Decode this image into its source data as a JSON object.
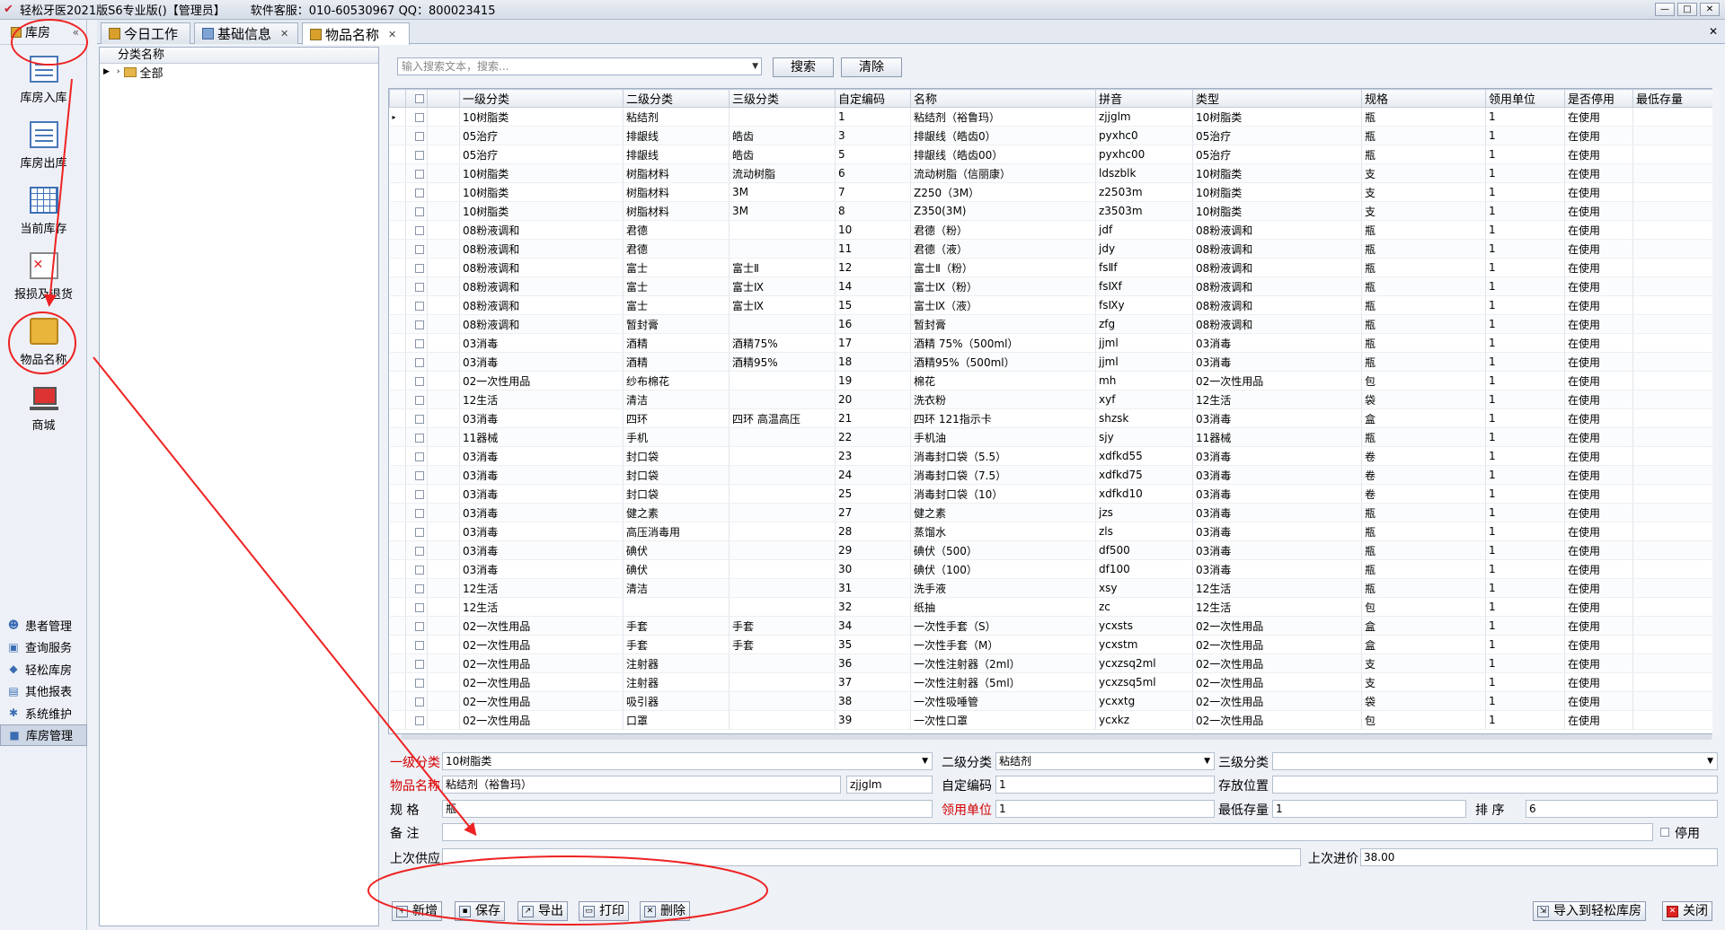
{
  "window": {
    "title": "轻松牙医2021版S6专业版()【管理员】",
    "service": "软件客服：010-60530967 QQ：800023415",
    "controls": [
      "—",
      "□",
      "✕"
    ]
  },
  "nav": {
    "header": "库房",
    "collapse": "«",
    "items": [
      {
        "label": "库房入库",
        "icon": "document-in-icon"
      },
      {
        "label": "库房出库",
        "icon": "document-out-icon"
      },
      {
        "label": "当前库存",
        "icon": "grid-table-icon"
      },
      {
        "label": "报损及退货",
        "icon": "return-icon"
      },
      {
        "label": "物品名称",
        "icon": "item-box-icon"
      },
      {
        "label": "商城",
        "icon": "cart-icon"
      }
    ],
    "modules": [
      {
        "label": "患者管理",
        "icon": "users-icon"
      },
      {
        "label": "查询服务",
        "icon": "query-icon"
      },
      {
        "label": "轻松库房",
        "icon": "warehouse-icon"
      },
      {
        "label": "其他报表",
        "icon": "report-icon"
      },
      {
        "label": "系统维护",
        "icon": "gear-icon"
      },
      {
        "label": "库房管理",
        "icon": "warehouse-manage-icon"
      }
    ]
  },
  "tabs": [
    {
      "label": "今日工作"
    },
    {
      "label": "基础信息"
    },
    {
      "label": "物品名称"
    }
  ],
  "tab_close": "✕",
  "tree": {
    "header": "分类名称",
    "root": "全部"
  },
  "search": {
    "placeholder": "输入搜索文本，搜索...",
    "search_label": "搜索",
    "clear_label": "清除"
  },
  "grid": {
    "columns": [
      "一级分类",
      "二级分类",
      "三级分类",
      "自定编码",
      "名称",
      "拼音",
      "类型",
      "规格",
      "领用单位",
      "是否停用",
      "最低存量"
    ],
    "rows": [
      [
        "10树脂类",
        "粘结剂",
        "",
        "1",
        "粘结剂（裕鲁玛）",
        "zjjglm",
        "10树脂类",
        "瓶",
        "1",
        "在使用"
      ],
      [
        "05治疗",
        "排龈线",
        "皓齿",
        "3",
        "排龈线（皓齿0）",
        "pyxhc0",
        "05治疗",
        "瓶",
        "1",
        "在使用"
      ],
      [
        "05治疗",
        "排龈线",
        "皓齿",
        "5",
        "排龈线（皓齿00）",
        "pyxhc00",
        "05治疗",
        "瓶",
        "1",
        "在使用"
      ],
      [
        "10树脂类",
        "树脂材料",
        "流动树脂",
        "6",
        "流动树脂（信丽康）",
        "ldszblk",
        "10树脂类",
        "支",
        "1",
        "在使用"
      ],
      [
        "10树脂类",
        "树脂材料",
        "3M",
        "7",
        "Z250（3M）",
        "z2503m",
        "10树脂类",
        "支",
        "1",
        "在使用"
      ],
      [
        "10树脂类",
        "树脂材料",
        "3M",
        "8",
        "Z350(3M)",
        "z3503m",
        "10树脂类",
        "支",
        "1",
        "在使用"
      ],
      [
        "08粉液调和",
        "君德",
        "",
        "10",
        "君德（粉）",
        "jdf",
        "08粉液调和",
        "瓶",
        "1",
        "在使用"
      ],
      [
        "08粉液调和",
        "君德",
        "",
        "11",
        "君德（液）",
        "jdy",
        "08粉液调和",
        "瓶",
        "1",
        "在使用"
      ],
      [
        "08粉液调和",
        "富士",
        "富士Ⅱ",
        "12",
        "富士Ⅱ（粉）",
        "fsⅡf",
        "08粉液调和",
        "瓶",
        "1",
        "在使用"
      ],
      [
        "08粉液调和",
        "富士",
        "富士Ⅸ",
        "14",
        "富士Ⅸ（粉）",
        "fsⅨf",
        "08粉液调和",
        "瓶",
        "1",
        "在使用"
      ],
      [
        "08粉液调和",
        "富士",
        "富士Ⅸ",
        "15",
        "富士Ⅸ（液）",
        "fsⅨy",
        "08粉液调和",
        "瓶",
        "1",
        "在使用"
      ],
      [
        "08粉液调和",
        "暂封膏",
        "",
        "16",
        "暂封膏",
        "zfg",
        "08粉液调和",
        "瓶",
        "1",
        "在使用"
      ],
      [
        "03消毒",
        "酒精",
        "酒精75%",
        "17",
        "酒精 75%（500ml）",
        "jjml",
        "03消毒",
        "瓶",
        "1",
        "在使用"
      ],
      [
        "03消毒",
        "酒精",
        "酒精95%",
        "18",
        "酒精95%（500ml）",
        "jjml",
        "03消毒",
        "瓶",
        "1",
        "在使用"
      ],
      [
        "02一次性用品",
        "纱布棉花",
        "",
        "19",
        "棉花",
        "mh",
        "02一次性用品",
        "包",
        "1",
        "在使用"
      ],
      [
        "12生活",
        "清洁",
        "",
        "20",
        "洗衣粉",
        "xyf",
        "12生活",
        "袋",
        "1",
        "在使用"
      ],
      [
        "03消毒",
        "四环",
        "四环 高温高压",
        "21",
        "四环 121指示卡",
        "shzsk",
        "03消毒",
        "盒",
        "1",
        "在使用"
      ],
      [
        "11器械",
        "手机",
        "",
        "22",
        "手机油",
        "sjy",
        "11器械",
        "瓶",
        "1",
        "在使用"
      ],
      [
        "03消毒",
        "封口袋",
        "",
        "23",
        "消毒封口袋（5.5）",
        "xdfkd55",
        "03消毒",
        "卷",
        "1",
        "在使用"
      ],
      [
        "03消毒",
        "封口袋",
        "",
        "24",
        "消毒封口袋（7.5）",
        "xdfkd75",
        "03消毒",
        "卷",
        "1",
        "在使用"
      ],
      [
        "03消毒",
        "封口袋",
        "",
        "25",
        "消毒封口袋（10）",
        "xdfkd10",
        "03消毒",
        "卷",
        "1",
        "在使用"
      ],
      [
        "03消毒",
        "健之素",
        "",
        "27",
        "健之素",
        "jzs",
        "03消毒",
        "瓶",
        "1",
        "在使用"
      ],
      [
        "03消毒",
        "高压消毒用",
        "",
        "28",
        "蒸馏水",
        "zls",
        "03消毒",
        "瓶",
        "1",
        "在使用"
      ],
      [
        "03消毒",
        "碘伏",
        "",
        "29",
        "碘伏（500）",
        "df500",
        "03消毒",
        "瓶",
        "1",
        "在使用"
      ],
      [
        "03消毒",
        "碘伏",
        "",
        "30",
        "碘伏（100）",
        "df100",
        "03消毒",
        "瓶",
        "1",
        "在使用"
      ],
      [
        "12生活",
        "清洁",
        "",
        "31",
        "洗手液",
        "xsy",
        "12生活",
        "瓶",
        "1",
        "在使用"
      ],
      [
        "12生活",
        "",
        "",
        "32",
        "纸抽",
        "zc",
        "12生活",
        "包",
        "1",
        "在使用"
      ],
      [
        "02一次性用品",
        "手套",
        "手套",
        "34",
        "一次性手套（S）",
        "ycxsts",
        "02一次性用品",
        "盒",
        "1",
        "在使用"
      ],
      [
        "02一次性用品",
        "手套",
        "手套",
        "35",
        "一次性手套（M）",
        "ycxstm",
        "02一次性用品",
        "盒",
        "1",
        "在使用"
      ],
      [
        "02一次性用品",
        "注射器",
        "",
        "36",
        "一次性注射器（2ml）",
        "ycxzsq2ml",
        "02一次性用品",
        "支",
        "1",
        "在使用"
      ],
      [
        "02一次性用品",
        "注射器",
        "",
        "37",
        "一次性注射器（5ml）",
        "ycxzsq5ml",
        "02一次性用品",
        "支",
        "1",
        "在使用"
      ],
      [
        "02一次性用品",
        "吸引器",
        "",
        "38",
        "一次性吸唾管",
        "ycxxtg",
        "02一次性用品",
        "袋",
        "1",
        "在使用"
      ],
      [
        "02一次性用品",
        "口罩",
        "",
        "39",
        "一次性口罩",
        "ycxkz",
        "02一次性用品",
        "包",
        "1",
        "在使用"
      ]
    ]
  },
  "form": {
    "level1_label": "一级分类",
    "level1_value": "10树脂类",
    "level2_label": "二级分类",
    "level2_value": "粘结剂",
    "level3_label": "三级分类",
    "level3_value": "",
    "name_label": "物品名称",
    "name_value": "粘结剂（裕鲁玛）",
    "pinyin_value": "zjjglm",
    "code_label": "自定编码",
    "code_value": "1",
    "location_label": "存放位置",
    "location_value": "",
    "spec_label": "规    格",
    "spec_value": "瓶",
    "unit_label": "领用单位",
    "unit_value": "1",
    "min_label": "最低存量",
    "min_value": "1",
    "sort_label": "排    序",
    "sort_value": "6",
    "note_label": "备    注",
    "note_value": "",
    "disable_label": "停用",
    "supplier_label": "上次供应",
    "supplier_value": "",
    "price_label": "上次进价",
    "price_value": "38.00"
  },
  "actions": {
    "add": "新增",
    "save": "保存",
    "export": "导出",
    "print": "打印",
    "delete": "删除",
    "import": "导入到轻松库房",
    "close": "关闭"
  },
  "annotation_color": "#ee2222"
}
